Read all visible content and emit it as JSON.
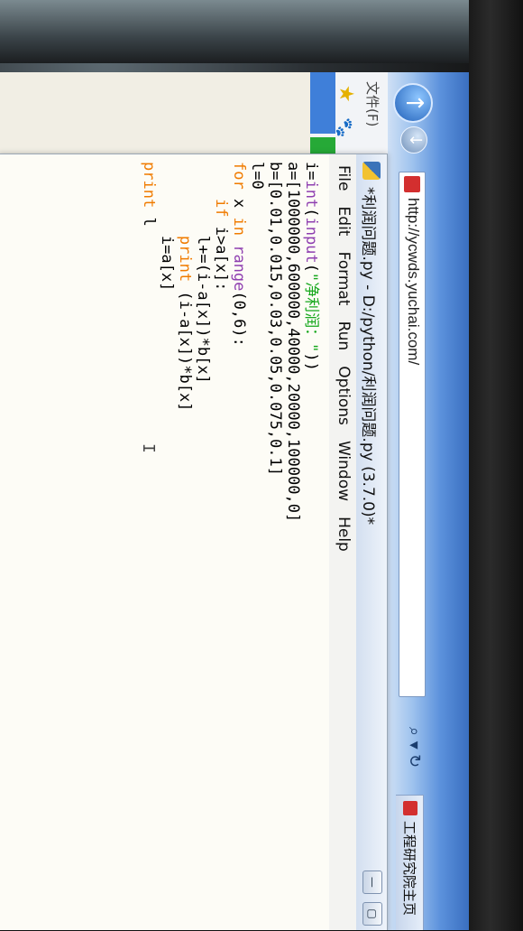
{
  "browser": {
    "url": "http://ycwds.yuchai.com/",
    "file_menu": "文件(F)",
    "other_tab_label": "工程研究院主页",
    "back_glyph": "↑",
    "forward_glyph": "↓",
    "search_glyph": "⌕ ▾",
    "refresh_glyph": "↻"
  },
  "idle": {
    "title": "*利润问题.py - D:/python/利润问题.py (3.7.0)*",
    "window_controls": [
      "—",
      "▢"
    ],
    "menu": [
      "File",
      "Edit",
      "Format",
      "Run",
      "Options",
      "Window",
      "Help"
    ],
    "code_lines": [
      "i=int(input(\"净利润：\"))",
      "a=[1000000,600000,40000,20000,100000,0]",
      "b=[0.01,0.015,0.03,0.05,0.075,0.1]",
      "l=0",
      "for x in range(0,6):",
      "    if i>a[x]:",
      "        l+=(i-a[x])*b[x]",
      "        print (i-a[x])*b[x]",
      "        i=a[x]",
      "print l"
    ],
    "cursor_glyph": "I"
  },
  "colors": {
    "keyword": "#f07b00",
    "builtin": "#8f3fb0",
    "string": "#18a81e"
  },
  "icons": [
    "back-arrow-icon",
    "forward-arrow-icon",
    "site-favicon-icon",
    "search-icon",
    "refresh-icon",
    "favorites-star-icon",
    "baidu-paw-icon",
    "idle-app-icon"
  ]
}
